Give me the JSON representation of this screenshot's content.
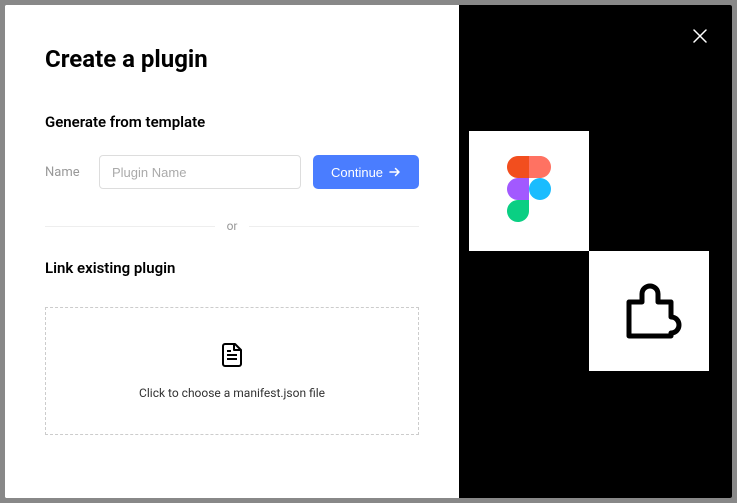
{
  "title": "Create a plugin",
  "generate": {
    "heading": "Generate from template",
    "name_label": "Name",
    "name_placeholder": "Plugin Name",
    "continue_label": "Continue"
  },
  "divider_text": "or",
  "link": {
    "heading": "Link existing plugin",
    "dropzone_text": "Click to choose a manifest.json file"
  }
}
